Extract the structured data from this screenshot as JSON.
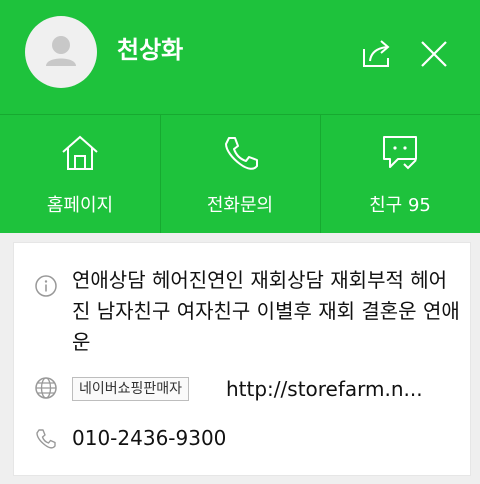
{
  "header": {
    "title": "천상화",
    "actions": [
      {
        "label": "홈페이지",
        "icon": "home-icon"
      },
      {
        "label": "전화문의",
        "icon": "phone-icon"
      },
      {
        "label": "친구 95",
        "icon": "friend-chat-icon"
      }
    ]
  },
  "info": {
    "description": "연애상담 헤어진연인 재회상담 재회부적 헤어진 남자친구 여자친구 이별후 재회 결혼운 연애운",
    "badge": "네이버쇼핑판매자",
    "url": "http://storefarm.n...",
    "phone": "010-2436-9300"
  },
  "colors": {
    "brand": "#1ec23c",
    "card": "#ffffff",
    "background": "#efefef"
  }
}
